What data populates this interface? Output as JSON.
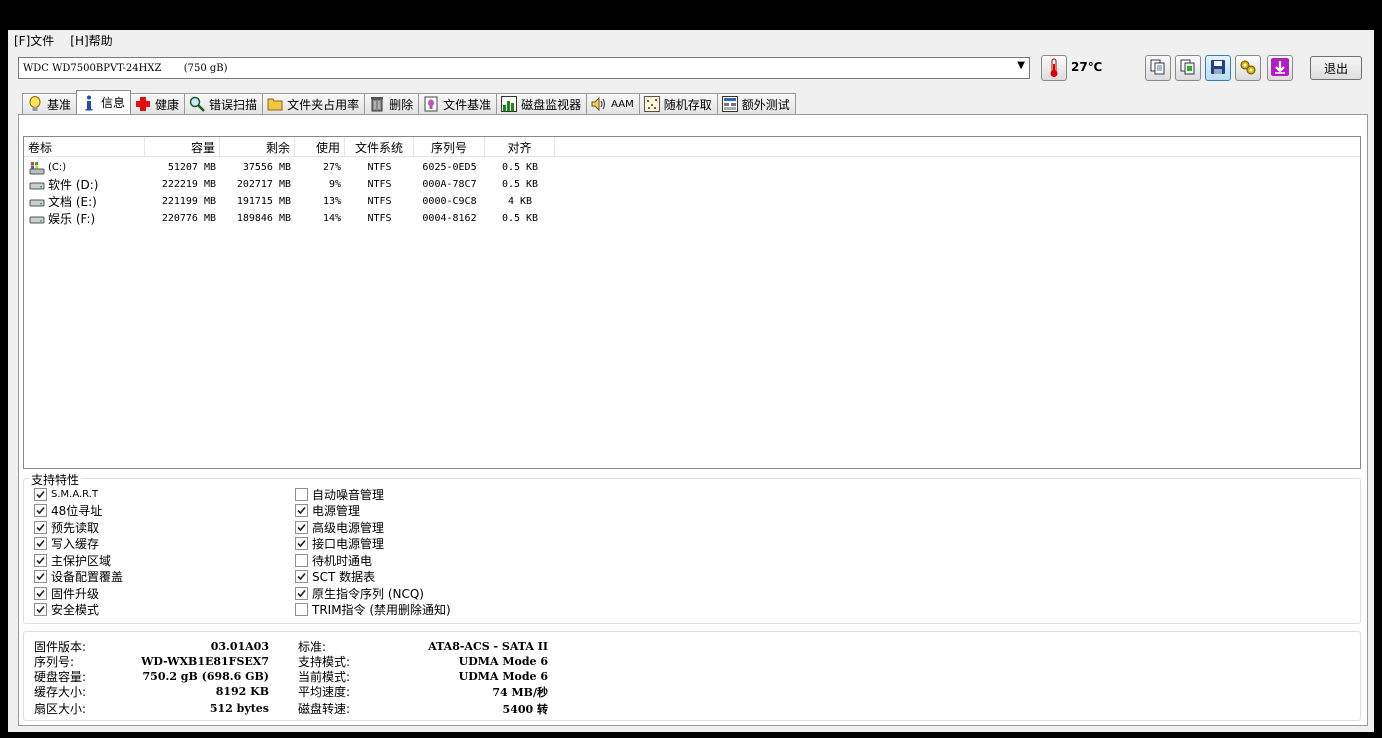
{
  "menu": {
    "file": "[F]文件",
    "help": "[H]帮助"
  },
  "toolbar": {
    "drive": "WDC WD7500BPVT-24HXZ       (750 gB)",
    "temperature": "27℃",
    "exit_label": "退出",
    "icons": [
      "copy-icon",
      "copy-all-icon",
      "save-icon",
      "options-icon",
      "download-icon"
    ]
  },
  "tabs": [
    {
      "label": "基准",
      "icon": "bulb-icon"
    },
    {
      "label": "信息",
      "icon": "info-icon",
      "active": true
    },
    {
      "label": "健康",
      "icon": "health-cross-icon"
    },
    {
      "label": "错误扫描",
      "icon": "magnifier-icon"
    },
    {
      "label": "文件夹占用率",
      "icon": "folder-icon"
    },
    {
      "label": "删除",
      "icon": "trash-icon"
    },
    {
      "label": "文件基准",
      "icon": "file-benchmark-icon"
    },
    {
      "label": "磁盘监视器",
      "icon": "chart-icon"
    },
    {
      "label": "AAM",
      "icon": "speaker-icon"
    },
    {
      "label": "随机存取",
      "icon": "random-access-icon"
    },
    {
      "label": "额外测试",
      "icon": "extra-tests-icon"
    }
  ],
  "volumes": {
    "headers": [
      "卷标",
      "容量",
      "剩余",
      "使用",
      "文件系统",
      "序列号",
      "对齐"
    ],
    "rows": [
      {
        "label": "(C:)",
        "capacity": "51207 MB",
        "free": "37556 MB",
        "used": "27%",
        "fs": "NTFS",
        "serial": "6025-0ED5",
        "align": "0.5 KB",
        "icon": "system-drive-icon"
      },
      {
        "label": "软件 (D:)",
        "capacity": "222219 MB",
        "free": "202717 MB",
        "used": "9%",
        "fs": "NTFS",
        "serial": "000A-78C7",
        "align": "0.5 KB",
        "icon": "drive-icon"
      },
      {
        "label": "文档 (E:)",
        "capacity": "221199 MB",
        "free": "191715 MB",
        "used": "13%",
        "fs": "NTFS",
        "serial": "0000-C9C8",
        "align": "4 KB",
        "icon": "drive-icon"
      },
      {
        "label": "娱乐 (F:)",
        "capacity": "220776 MB",
        "free": "189846 MB",
        "used": "14%",
        "fs": "NTFS",
        "serial": "0004-8162",
        "align": "0.5 KB",
        "icon": "drive-icon"
      }
    ]
  },
  "features": {
    "title": "支持特性",
    "left": [
      {
        "label": "S.M.A.R.T",
        "checked": true
      },
      {
        "label": "48位寻址",
        "checked": true
      },
      {
        "label": "预先读取",
        "checked": true
      },
      {
        "label": "写入缓存",
        "checked": true
      },
      {
        "label": "主保护区域",
        "checked": true
      },
      {
        "label": "设备配置覆盖",
        "checked": true
      },
      {
        "label": "固件升级",
        "checked": true
      },
      {
        "label": "安全模式",
        "checked": true
      }
    ],
    "right": [
      {
        "label": "自动噪音管理",
        "checked": false
      },
      {
        "label": "电源管理",
        "checked": true
      },
      {
        "label": "高级电源管理",
        "checked": true
      },
      {
        "label": "接口电源管理",
        "checked": true
      },
      {
        "label": "待机时通电",
        "checked": false
      },
      {
        "label": "SCT 数据表",
        "checked": true
      },
      {
        "label": "原生指令序列 (NCQ)",
        "checked": true
      },
      {
        "label": "TRIM指令 (禁用删除通知)",
        "checked": false
      }
    ]
  },
  "info": {
    "left": [
      {
        "label": "固件版本:",
        "value": "03.01A03"
      },
      {
        "label": "序列号:",
        "value": "WD-WXB1E81FSEX7"
      },
      {
        "label": "硬盘容量:",
        "value": "750.2 gB (698.6 GB)"
      },
      {
        "label": "缓存大小:",
        "value": "8192 KB"
      },
      {
        "label": "扇区大小:",
        "value": "512 bytes"
      }
    ],
    "right": [
      {
        "label": "标准:",
        "value": "ATA8-ACS - SATA II"
      },
      {
        "label": "支持模式:",
        "value": "UDMA Mode 6"
      },
      {
        "label": "当前模式:",
        "value": "UDMA Mode 6"
      },
      {
        "label": "平均速度:",
        "value": "74 MB/秒"
      },
      {
        "label": "磁盘转速:",
        "value": "5400 转"
      }
    ]
  }
}
